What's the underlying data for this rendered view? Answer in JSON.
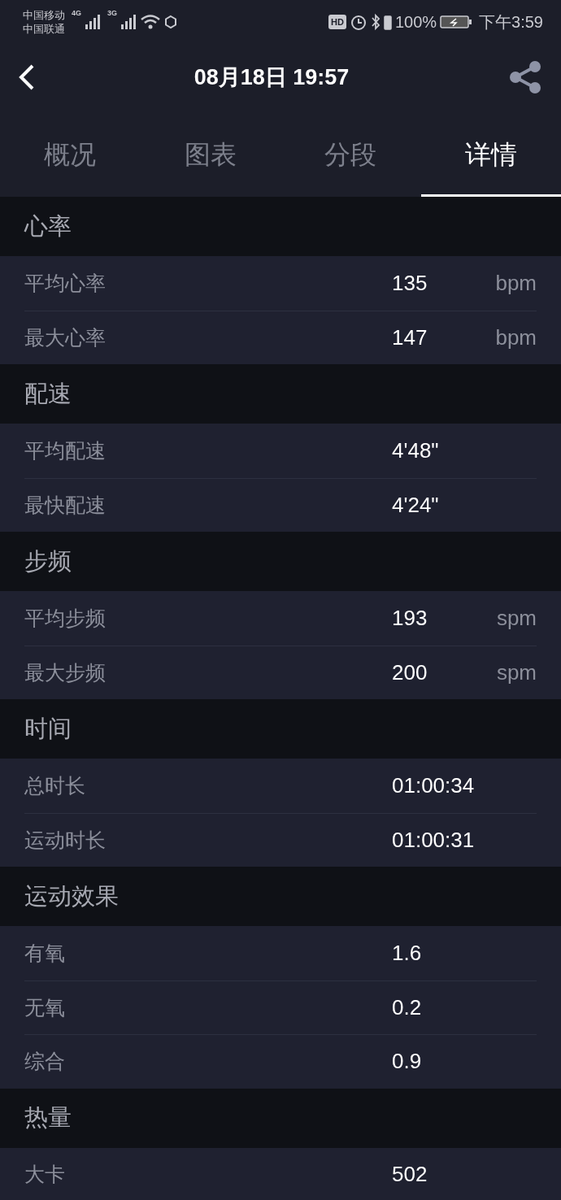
{
  "status_bar": {
    "carriers": [
      "中国移动",
      "中国联通"
    ],
    "network_1": "4G",
    "network_2": "3G",
    "hd_badge": "HD",
    "battery_percent": "100%",
    "time": "下午3:59"
  },
  "header": {
    "title": "08月18日 19:57"
  },
  "tabs": [
    {
      "label": "概况",
      "selected": false
    },
    {
      "label": "图表",
      "selected": false
    },
    {
      "label": "分段",
      "selected": false
    },
    {
      "label": "详情",
      "selected": true
    }
  ],
  "sections": [
    {
      "title": "心率",
      "rows": [
        {
          "label": "平均心率",
          "value": "135",
          "unit": "bpm"
        },
        {
          "label": "最大心率",
          "value": "147",
          "unit": "bpm"
        }
      ]
    },
    {
      "title": "配速",
      "rows": [
        {
          "label": "平均配速",
          "value": "4'48\""
        },
        {
          "label": "最快配速",
          "value": "4'24\""
        }
      ]
    },
    {
      "title": "步频",
      "rows": [
        {
          "label": "平均步频",
          "value": "193",
          "unit": "spm"
        },
        {
          "label": "最大步频",
          "value": "200",
          "unit": "spm"
        }
      ]
    },
    {
      "title": "时间",
      "rows": [
        {
          "label": "总时长",
          "value": "01:00:34"
        },
        {
          "label": "运动时长",
          "value": "01:00:31"
        }
      ]
    },
    {
      "title": "运动效果",
      "rows": [
        {
          "label": "有氧",
          "value": "1.6"
        },
        {
          "label": "无氧",
          "value": "0.2"
        },
        {
          "label": "综合",
          "value": "0.9"
        }
      ]
    },
    {
      "title": "热量",
      "rows": [
        {
          "label": "大卡",
          "value": "502"
        }
      ]
    }
  ]
}
